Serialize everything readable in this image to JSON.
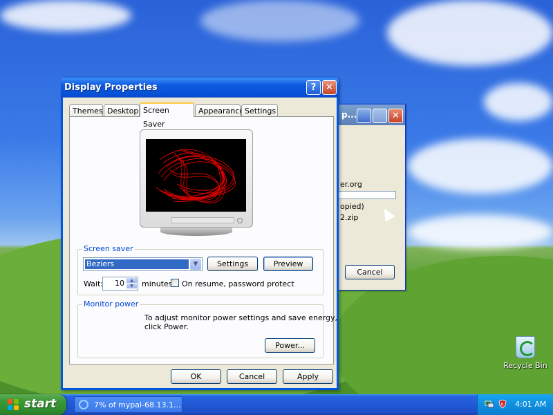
{
  "dialog": {
    "title": "Display Properties",
    "help_label": "?",
    "close_label": "✕",
    "tabs": [
      {
        "label": "Themes"
      },
      {
        "label": "Desktop"
      },
      {
        "label": "Screen Saver",
        "active": true
      },
      {
        "label": "Appearance"
      },
      {
        "label": "Settings"
      }
    ],
    "screen_saver": {
      "group_label": "Screen saver",
      "selected": "Beziers",
      "settings_label": "Settings",
      "preview_label": "Preview",
      "wait_label": "Wait:",
      "wait_value": "10",
      "minutes_label": "minutes",
      "password_label": "On resume, password protect",
      "password_checked": false
    },
    "monitor_power": {
      "group_label": "Monitor power",
      "description_line1": "To adjust monitor power settings and save energy,",
      "description_line2": "click Power.",
      "power_label": "Power..."
    },
    "buttons": {
      "ok": "OK",
      "cancel": "Cancel",
      "apply": "Apply"
    }
  },
  "background_window": {
    "title": "p...",
    "line1": "er.org",
    "line2": "opied)",
    "line3": "2.zip",
    "cancel_label": "Cancel",
    "close_label": "✕"
  },
  "desktop": {
    "recycle_bin_label": "Recycle Bin"
  },
  "taskbar": {
    "start_label": "start",
    "task_item": "7% of mypal-68.13.1...",
    "clock": "4:01 AM"
  },
  "colors": {
    "title_blue": "#0a5fe8",
    "start_green": "#3c9a37",
    "selection_blue": "#316ac5",
    "group_label_blue": "#0046d5"
  }
}
